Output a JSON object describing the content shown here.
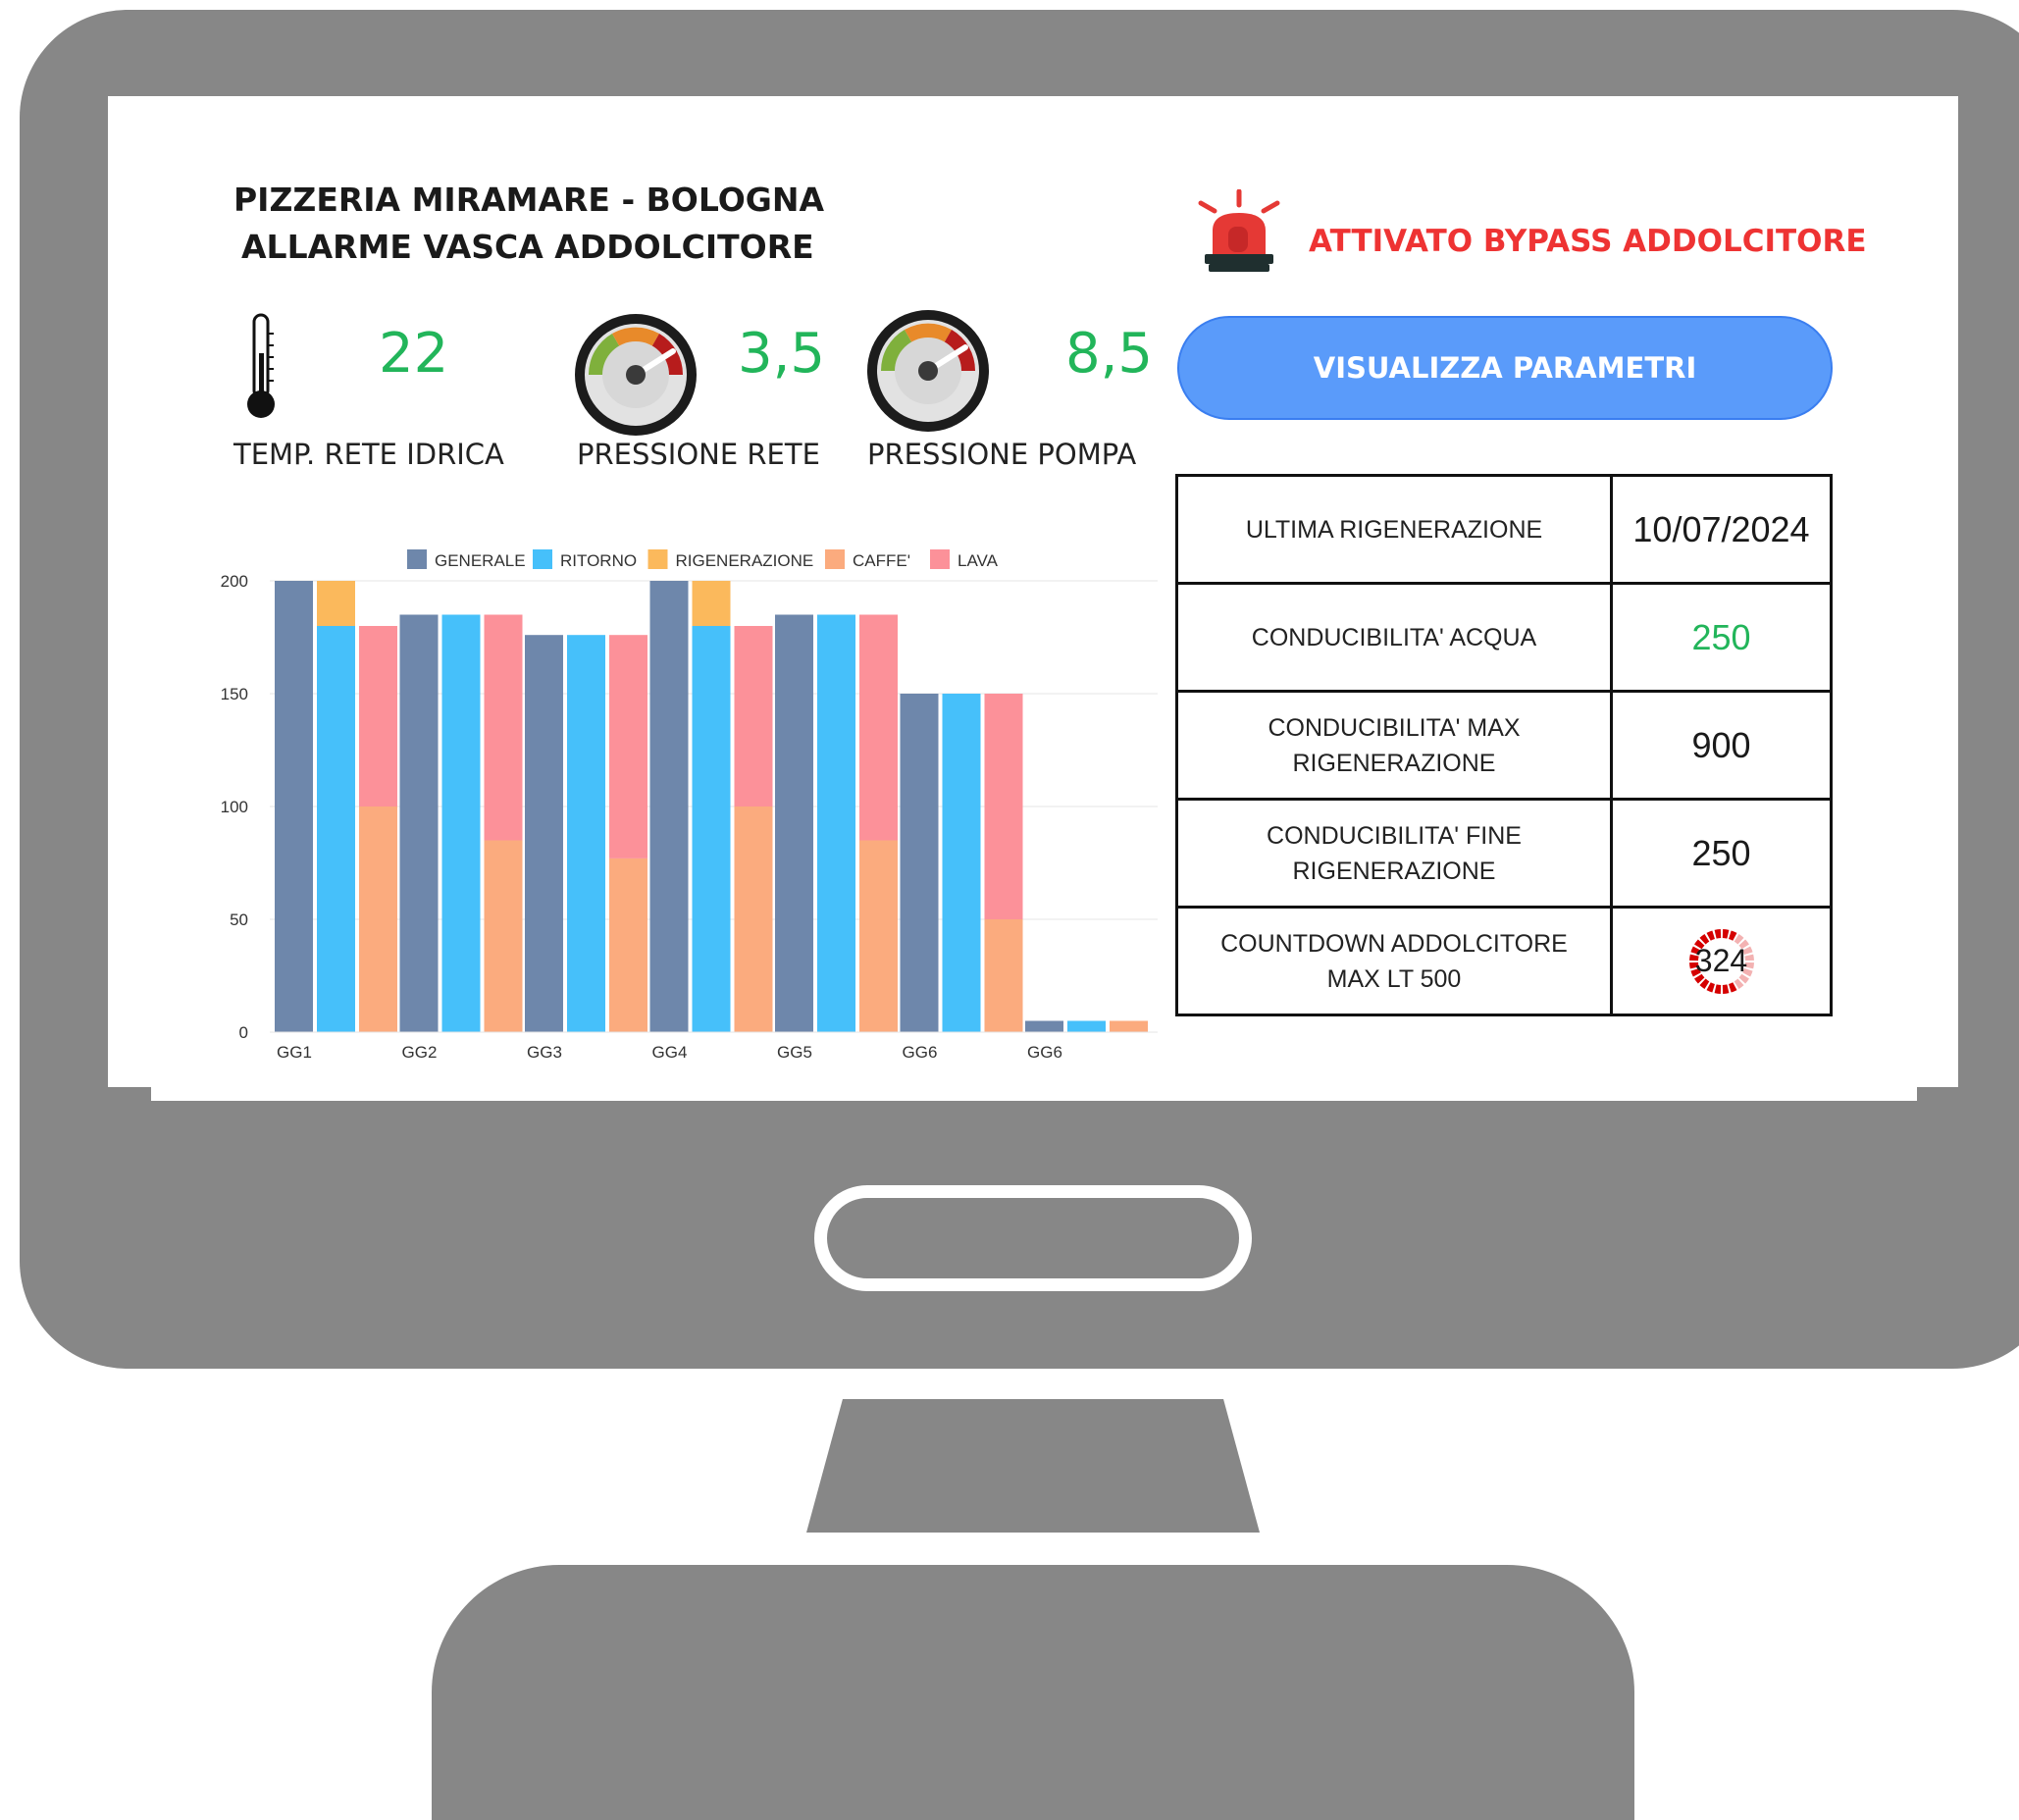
{
  "header": {
    "title_line1": "PIZZERIA MIRAMARE - BOLOGNA",
    "title_line2": "ALLARME VASCA ADDOLCITORE"
  },
  "alarm": {
    "text": "ATTIVATO BYPASS ADDOLCITORE",
    "icon": "siren-icon",
    "color": "#ee3333"
  },
  "metrics": {
    "temperature": {
      "value": "22",
      "label": "TEMP. RETE IDRICA",
      "icon": "thermometer-icon"
    },
    "network_pressure": {
      "value": "3,5",
      "label": "PRESSIONE RETE",
      "icon": "gauge-icon"
    },
    "pump_pressure": {
      "value": "8,5",
      "label": "PRESSIONE POMPA",
      "icon": "gauge-icon"
    }
  },
  "actions": {
    "view_params_label": "VISUALIZZA PARAMETRI"
  },
  "parameters": [
    {
      "label": "ULTIMA RIGENERAZIONE",
      "value": "10/07/2024"
    },
    {
      "label": "CONDUCIBILITA' ACQUA",
      "value": "250",
      "value_color": "#22b55a"
    },
    {
      "label_line1": "CONDUCIBILITA' MAX",
      "label_line2": "RIGENERAZIONE",
      "value": "900"
    },
    {
      "label_line1": "CONDUCIBILITA' FINE",
      "label_line2": "RIGENERAZIONE",
      "value": "250"
    },
    {
      "label_line1": "COUNTDOWN ADDOLCITORE",
      "label_line2": "MAX LT 500",
      "value": "324",
      "max": 500
    }
  ],
  "chart_data": {
    "type": "bar",
    "categories": [
      "GG1",
      "GG2",
      "GG3",
      "GG4",
      "GG5",
      "GG6",
      "GG6"
    ],
    "ylim": [
      0,
      200
    ],
    "yticks": [
      0,
      50,
      100,
      150,
      200
    ],
    "grid": true,
    "legend_position": "top",
    "legend": [
      {
        "name": "GENERALE",
        "color": "#6e87ab"
      },
      {
        "name": "RITORNO",
        "color": "#46c0fa"
      },
      {
        "name": "RIGENERAZIONE",
        "color": "#fbb95c"
      },
      {
        "name": "CAFFE'",
        "color": "#fbab7e"
      },
      {
        "name": "LAVA",
        "color": "#fc9199"
      }
    ],
    "groups": [
      {
        "category": "GG1",
        "generale": 200,
        "ritorno": 180,
        "rigenerazione": 20,
        "caffe": 100,
        "lava": 80
      },
      {
        "category": "GG2",
        "generale": 185,
        "ritorno": 185,
        "rigenerazione": 0,
        "caffe": 85,
        "lava": 100
      },
      {
        "category": "GG3",
        "generale": 176,
        "ritorno": 176,
        "rigenerazione": 0,
        "caffe": 77,
        "lava": 99
      },
      {
        "category": "GG4",
        "generale": 200,
        "ritorno": 180,
        "rigenerazione": 20,
        "caffe": 100,
        "lava": 80
      },
      {
        "category": "GG5",
        "generale": 185,
        "ritorno": 185,
        "rigenerazione": 0,
        "caffe": 85,
        "lava": 100
      },
      {
        "category": "GG6",
        "generale": 150,
        "ritorno": 150,
        "rigenerazione": 0,
        "caffe": 50,
        "lava": 100
      },
      {
        "category": "GG6",
        "generale": 5,
        "ritorno": 5,
        "rigenerazione": 0,
        "caffe": 5,
        "lava": 0
      }
    ]
  }
}
